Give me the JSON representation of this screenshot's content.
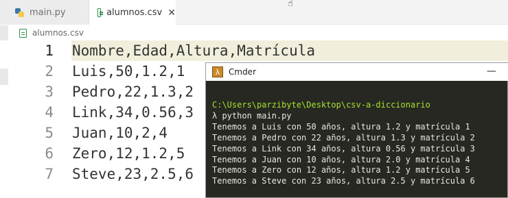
{
  "tabs": [
    {
      "label": "main.py",
      "icon": "python-file-icon",
      "active": false
    },
    {
      "label": "alumnos.csv",
      "icon": "csv-file-icon",
      "active": true
    }
  ],
  "breadcrumb": {
    "label": "alumnos.csv"
  },
  "editor": {
    "current_line": 1,
    "lines": [
      {
        "num": "1",
        "text": "Nombre,Edad,Altura,Matrícula"
      },
      {
        "num": "2",
        "text": "Luis,50,1.2,1"
      },
      {
        "num": "3",
        "text": "Pedro,22,1.3,2"
      },
      {
        "num": "4",
        "text": "Link,34,0.56,3"
      },
      {
        "num": "5",
        "text": "Juan,10,2,4"
      },
      {
        "num": "6",
        "text": "Zero,12,1.2,5"
      },
      {
        "num": "7",
        "text": "Steve,23,2.5,6"
      }
    ]
  },
  "cmder": {
    "title": "Cmder",
    "minimize": "—",
    "path": "C:\\Users\\parzibyte\\Desktop\\csv-a-diccionario",
    "command": "λ python main.py",
    "output": [
      "Tenemos a Luis con 50 años, altura 1.2 y matrícula 1",
      "Tenemos a Pedro con 22 años, altura 1.3 y matrícula 2",
      "Tenemos a Link con 34 años, altura 0.56 y matrícula 3",
      "Tenemos a Juan con 10 años, altura 2.0 y matrícula 4",
      "Tenemos a Zero con 12 años, altura 1.2 y matrícula 5",
      "Tenemos a Steve con 23 años, altura 2.5 y matrícula 6"
    ]
  },
  "colors": {
    "terminal_bg": "#272822",
    "path_green": "#a6e22e",
    "current_line_bg": "#f1efdc"
  }
}
